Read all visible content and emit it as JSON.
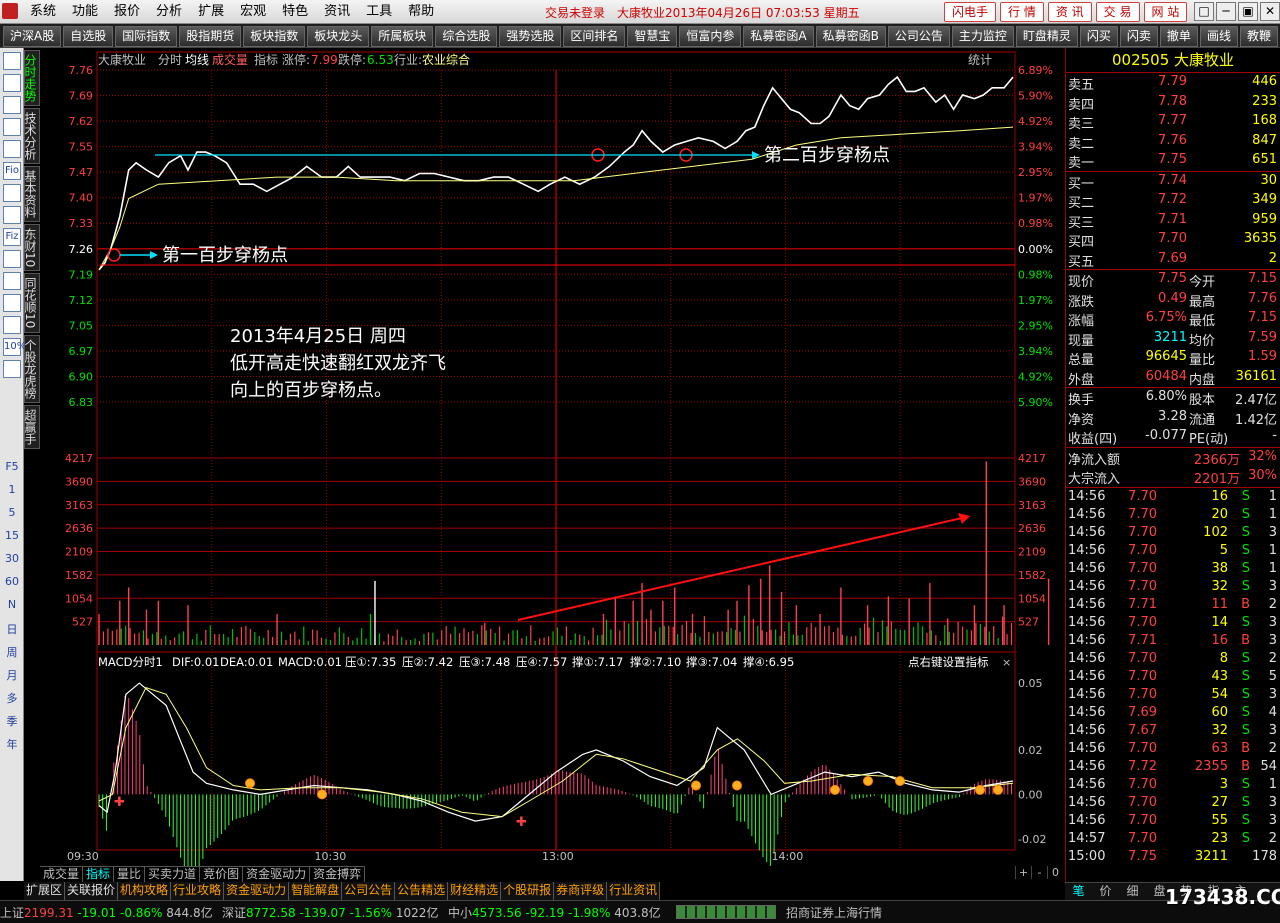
{
  "menubar": {
    "items": [
      "系统",
      "功能",
      "报价",
      "分析",
      "扩展",
      "宏观",
      "特色",
      "资讯",
      "工具",
      "帮助"
    ],
    "title": "交易未登录　大康牧业2013年04月26日 07:03:53 星期五",
    "links": [
      "闪电手",
      "行 情",
      "资 讯",
      "交 易",
      "网 站"
    ],
    "window_controls": [
      "□",
      "─",
      "▣",
      "✕"
    ]
  },
  "toolbar": {
    "buttons": [
      "沪深A股",
      "自选股",
      "国际指数",
      "股指期货",
      "板块指数",
      "板块龙头",
      "所属板块",
      "综合选股",
      "强势选股",
      "区间排名",
      "智慧宝",
      "恒富内参",
      "私募密函A",
      "私募密函B",
      "公司公告",
      "主力监控",
      "盯盘精灵",
      "闪买",
      "闪卖",
      "撤单",
      "画线",
      "教鞭"
    ]
  },
  "left_icons": [
    "page-icon",
    "table-icon",
    "line-chart-icon",
    "kline-icon",
    "report-icon",
    "fio-icon",
    "f10-icon",
    "star-icon",
    "fiz-icon",
    "news-icon",
    "search-icon",
    "wave-icon",
    "bars-icon",
    "percent-icon",
    "pen-icon"
  ],
  "left_icon_texts": [
    "",
    "",
    "",
    "",
    "",
    "Fio",
    "",
    "",
    "Fiz",
    "",
    "",
    "",
    "",
    "10%",
    ""
  ],
  "left_periods": [
    "F5",
    "1",
    "5",
    "15",
    "30",
    "60",
    "N",
    "日",
    "周",
    "月",
    "多",
    "季",
    "年"
  ],
  "vertical_tabs": [
    "分时走势",
    "技术分析",
    "基本资料",
    "东财10",
    "同花顺10",
    "个股龙虎榜",
    "超赢手"
  ],
  "chart": {
    "header": {
      "name": "大康牧业",
      "mode": "分时",
      "avg_label": "均线",
      "vol_label": "成交量",
      "indicator": "指标",
      "limit_up_label": "涨停:",
      "limit_up": "7.99",
      "limit_down_label": "跌停:",
      "limit_down": "6.53",
      "industry_label": "行业:",
      "industry": "农业综合",
      "stats": "统计"
    },
    "price_labels": [
      "7.76",
      "7.69",
      "7.62",
      "7.55",
      "7.47",
      "7.40",
      "7.33",
      "7.26",
      "7.19",
      "7.12",
      "7.05",
      "6.97",
      "6.90",
      "6.83"
    ],
    "pct_labels": [
      "6.89%",
      "5.90%",
      "4.92%",
      "3.94%",
      "2.95%",
      "1.97%",
      "0.98%",
      "0.00%",
      "0.98%",
      "1.97%",
      "2.95%",
      "3.94%",
      "4.92%",
      "5.90%"
    ],
    "vol_labels": [
      "4217",
      "3690",
      "3163",
      "2636",
      "2109",
      "1582",
      "1054",
      "527"
    ],
    "macd_header": [
      "MACD分时1",
      "DIF:0.01",
      "DEA:0.01",
      "MACD:0.01",
      "压①:7.35",
      "压②:7.42",
      "压③:7.48",
      "压④:7.57",
      "撑①:7.17",
      "撑②:7.10",
      "撑③:7.04",
      "撑④:6.95"
    ],
    "macd_hint": "点右键设置指标",
    "macd_labels": [
      "0.05",
      "0.02",
      "0.00",
      "-0.02"
    ],
    "time_labels": [
      "09:30",
      "10:30",
      "13:00",
      "14:00"
    ],
    "annotation1": "第一百步穿杨点",
    "annotation2": "第二百步穿杨点",
    "note_lines": [
      "2013年4月25日 周四",
      "低开高走快速翻红双龙齐飞",
      "向上的百步穿杨点。"
    ],
    "colors": {
      "up": "#ff4040",
      "down": "#00e000",
      "price": "#ffffff",
      "avg": "#ffff80",
      "grid": "#a00000",
      "axis": "#ff4040"
    }
  },
  "chart_data": {
    "type": "line",
    "title": "大康牧业 分时",
    "ylim": [
      6.83,
      7.76
    ],
    "time_range": [
      "09:30",
      "15:00"
    ],
    "series": [
      {
        "name": "价格",
        "points": [
          [
            0,
            7.2
          ],
          [
            4,
            7.22
          ],
          [
            8,
            7.26
          ],
          [
            14,
            7.35
          ],
          [
            20,
            7.48
          ],
          [
            25,
            7.5
          ],
          [
            32,
            7.48
          ],
          [
            40,
            7.46
          ],
          [
            47,
            7.5
          ],
          [
            55,
            7.52
          ],
          [
            60,
            7.48
          ],
          [
            66,
            7.53
          ],
          [
            72,
            7.53
          ],
          [
            78,
            7.52
          ],
          [
            86,
            7.5
          ],
          [
            95,
            7.44
          ],
          [
            104,
            7.44
          ],
          [
            113,
            7.42
          ],
          [
            122,
            7.44
          ],
          [
            131,
            7.46
          ],
          [
            140,
            7.49
          ],
          [
            150,
            7.46
          ],
          [
            160,
            7.46
          ],
          [
            168,
            7.49
          ],
          [
            176,
            7.46
          ],
          [
            186,
            7.46
          ],
          [
            196,
            7.46
          ],
          [
            206,
            7.45
          ],
          [
            216,
            7.47
          ],
          [
            226,
            7.47
          ],
          [
            236,
            7.46
          ],
          [
            246,
            7.45
          ],
          [
            256,
            7.45
          ],
          [
            266,
            7.46
          ],
          [
            276,
            7.46
          ],
          [
            286,
            7.44
          ],
          [
            296,
            7.42
          ],
          [
            304,
            7.44
          ],
          [
            314,
            7.46
          ],
          [
            324,
            7.44
          ],
          [
            334,
            7.46
          ],
          [
            344,
            7.49
          ],
          [
            354,
            7.53
          ],
          [
            360,
            7.55
          ],
          [
            366,
            7.59
          ],
          [
            372,
            7.56
          ],
          [
            380,
            7.53
          ],
          [
            388,
            7.55
          ],
          [
            396,
            7.56
          ],
          [
            404,
            7.57
          ],
          [
            414,
            7.56
          ],
          [
            422,
            7.54
          ],
          [
            430,
            7.56
          ],
          [
            436,
            7.59
          ],
          [
            442,
            7.6
          ],
          [
            448,
            7.66
          ],
          [
            454,
            7.71
          ],
          [
            460,
            7.68
          ],
          [
            466,
            7.65
          ],
          [
            472,
            7.64
          ],
          [
            480,
            7.61
          ],
          [
            486,
            7.61
          ],
          [
            492,
            7.63
          ],
          [
            500,
            7.69
          ],
          [
            506,
            7.66
          ],
          [
            512,
            7.65
          ],
          [
            518,
            7.68
          ],
          [
            526,
            7.69
          ],
          [
            532,
            7.72
          ],
          [
            538,
            7.74
          ],
          [
            544,
            7.7
          ],
          [
            550,
            7.7
          ],
          [
            556,
            7.71
          ],
          [
            564,
            7.67
          ],
          [
            570,
            7.69
          ],
          [
            576,
            7.65
          ],
          [
            582,
            7.69
          ],
          [
            590,
            7.68
          ],
          [
            596,
            7.69
          ],
          [
            602,
            7.71
          ],
          [
            610,
            7.71
          ],
          [
            616,
            7.74
          ]
        ]
      },
      {
        "name": "均价",
        "points": [
          [
            0,
            7.2
          ],
          [
            8,
            7.26
          ],
          [
            14,
            7.32
          ],
          [
            20,
            7.4
          ],
          [
            40,
            7.44
          ],
          [
            80,
            7.45
          ],
          [
            120,
            7.46
          ],
          [
            160,
            7.46
          ],
          [
            200,
            7.45
          ],
          [
            240,
            7.45
          ],
          [
            280,
            7.45
          ],
          [
            320,
            7.45
          ],
          [
            340,
            7.46
          ],
          [
            360,
            7.47
          ],
          [
            400,
            7.49
          ],
          [
            440,
            7.51
          ],
          [
            470,
            7.55
          ],
          [
            500,
            7.57
          ],
          [
            540,
            7.58
          ],
          [
            580,
            7.59
          ],
          [
            616,
            7.6
          ]
        ]
      }
    ],
    "volume_spikes": [
      [
        0,
        700
      ],
      [
        14,
        1000
      ],
      [
        20,
        1300
      ],
      [
        32,
        800
      ],
      [
        40,
        1000
      ],
      [
        60,
        900
      ],
      [
        120,
        700
      ],
      [
        183,
        700
      ],
      [
        186,
        1450
      ],
      [
        260,
        500
      ],
      [
        340,
        700
      ],
      [
        348,
        1100
      ],
      [
        360,
        1000
      ],
      [
        366,
        1400
      ],
      [
        372,
        800
      ],
      [
        380,
        1000
      ],
      [
        388,
        1300
      ],
      [
        400,
        700
      ],
      [
        424,
        800
      ],
      [
        430,
        1000
      ],
      [
        438,
        1350
      ],
      [
        446,
        1500
      ],
      [
        452,
        1800
      ],
      [
        460,
        1200
      ],
      [
        470,
        900
      ],
      [
        486,
        700
      ],
      [
        500,
        1300
      ],
      [
        518,
        900
      ],
      [
        532,
        1100
      ],
      [
        546,
        1050
      ],
      [
        560,
        1400
      ],
      [
        572,
        600
      ],
      [
        590,
        900
      ],
      [
        598,
        4150
      ],
      [
        610,
        900
      ],
      [
        640,
        1500
      ],
      [
        660,
        700
      ],
      [
        680,
        1000
      ],
      [
        698,
        2450
      ],
      [
        708,
        2000
      ],
      [
        716,
        800
      ],
      [
        728,
        2700
      ]
    ],
    "macd_range": [
      -0.025,
      0.055
    ],
    "macd_dif": [
      [
        0,
        -0.005
      ],
      [
        6,
        -0.008
      ],
      [
        12,
        0.01
      ],
      [
        20,
        0.045
      ],
      [
        30,
        0.05
      ],
      [
        40,
        0.045
      ],
      [
        50,
        0.04
      ],
      [
        60,
        0.025
      ],
      [
        70,
        0.01
      ],
      [
        80,
        0.005
      ],
      [
        100,
        0.002
      ],
      [
        120,
        0
      ],
      [
        140,
        0.002
      ],
      [
        160,
        0.004
      ],
      [
        180,
        0.003
      ],
      [
        200,
        0.002
      ],
      [
        220,
        0
      ],
      [
        240,
        -0.003
      ],
      [
        260,
        -0.008
      ],
      [
        280,
        -0.012
      ],
      [
        300,
        -0.01
      ],
      [
        320,
        0
      ],
      [
        340,
        0.01
      ],
      [
        360,
        0.018
      ],
      [
        370,
        0.02
      ],
      [
        390,
        0.015
      ],
      [
        410,
        0.008
      ],
      [
        430,
        0.004
      ],
      [
        450,
        0.012
      ],
      [
        460,
        0.03
      ],
      [
        470,
        0.025
      ],
      [
        480,
        0.02
      ],
      [
        490,
        0.01
      ],
      [
        500,
        0
      ],
      [
        520,
        0.005
      ],
      [
        540,
        0.01
      ],
      [
        560,
        0.008
      ],
      [
        580,
        0.01
      ],
      [
        600,
        0.005
      ],
      [
        620,
        0.002
      ],
      [
        640,
        0.001
      ],
      [
        660,
        0.004
      ],
      [
        680,
        0.006
      ]
    ],
    "macd_dea": [
      [
        0,
        -0.003
      ],
      [
        10,
        0
      ],
      [
        20,
        0.03
      ],
      [
        35,
        0.048
      ],
      [
        50,
        0.045
      ],
      [
        65,
        0.03
      ],
      [
        80,
        0.012
      ],
      [
        100,
        0.004
      ],
      [
        120,
        0.002
      ],
      [
        150,
        0.003
      ],
      [
        180,
        0.003
      ],
      [
        210,
        0.001
      ],
      [
        240,
        -0.002
      ],
      [
        270,
        -0.008
      ],
      [
        300,
        -0.01
      ],
      [
        320,
        -0.003
      ],
      [
        345,
        0.006
      ],
      [
        370,
        0.018
      ],
      [
        390,
        0.016
      ],
      [
        420,
        0.01
      ],
      [
        440,
        0.006
      ],
      [
        460,
        0.02
      ],
      [
        475,
        0.025
      ],
      [
        495,
        0.015
      ],
      [
        510,
        0.005
      ],
      [
        530,
        0.006
      ],
      [
        560,
        0.009
      ],
      [
        590,
        0.008
      ],
      [
        620,
        0.003
      ],
      [
        650,
        0.003
      ],
      [
        680,
        0.005
      ]
    ]
  },
  "chart_tabs": [
    "成交量",
    "指标",
    "量比",
    "买卖力道",
    "竞价图",
    "资金驱动力",
    "资金搏弈"
  ],
  "chart_tabs_active": 1,
  "nav_controls": [
    "+",
    "-",
    "0"
  ],
  "bottom_tabs": [
    "扩展区",
    "关联报价",
    "机构攻略",
    "行业攻略",
    "资金驱动力",
    "智能解盘",
    "公司公告",
    "公告精选",
    "财经精选",
    "个股研报",
    "券商评级",
    "行业资讯"
  ],
  "statusbar": {
    "sh_label": "上证",
    "sh": "2199.31",
    "sh_chg": "-19.01",
    "sh_pct": "-0.86%",
    "sh_amt": "844.8亿",
    "sz_label": "深证",
    "sz": "8772.58",
    "sz_chg": "-139.07",
    "sz_pct": "-1.56%",
    "sz_amt": "1022亿",
    "sm_label": "中小",
    "sm": "4573.56",
    "sm_chg": "-92.19",
    "sm_pct": "-1.98%",
    "sm_amt": "403.8亿",
    "broker": "招商证券上海行情"
  },
  "quote": {
    "title": "002505 大康牧业",
    "asks": [
      [
        "卖五",
        "7.79",
        "446"
      ],
      [
        "卖四",
        "7.78",
        "233"
      ],
      [
        "卖三",
        "7.77",
        "168"
      ],
      [
        "卖二",
        "7.76",
        "847"
      ],
      [
        "卖一",
        "7.75",
        "651"
      ]
    ],
    "bids": [
      [
        "买一",
        "7.74",
        "30"
      ],
      [
        "买二",
        "7.72",
        "349"
      ],
      [
        "买三",
        "7.71",
        "959"
      ],
      [
        "买四",
        "7.70",
        "3635"
      ],
      [
        "买五",
        "7.69",
        "2"
      ]
    ],
    "stats": [
      [
        "现价",
        "7.75",
        "今开",
        "7.15"
      ],
      [
        "涨跌",
        "0.49",
        "最高",
        "7.76"
      ],
      [
        "涨幅",
        "6.75%",
        "最低",
        "7.15"
      ],
      [
        "现量",
        "3211",
        "均价",
        "7.59"
      ],
      [
        "总量",
        "96645",
        "量比",
        "1.59"
      ],
      [
        "外盘",
        "60484",
        "内盘",
        "36161"
      ]
    ],
    "funds": [
      [
        "换手",
        "6.80%",
        "股本",
        "2.47亿"
      ],
      [
        "净资",
        "3.28",
        "流通",
        "1.42亿"
      ],
      [
        "收益(四)",
        "-0.077",
        "PE(动)",
        "-"
      ]
    ],
    "flows": [
      [
        "净流入额",
        "2366万",
        "32%"
      ],
      [
        "大宗流入",
        "2201万",
        "30%"
      ]
    ],
    "ticks": [
      [
        "14:56",
        "7.70",
        "16",
        "S",
        "1"
      ],
      [
        "14:56",
        "7.70",
        "20",
        "S",
        "1"
      ],
      [
        "14:56",
        "7.70",
        "102",
        "S",
        "3"
      ],
      [
        "14:56",
        "7.70",
        "5",
        "S",
        "1"
      ],
      [
        "14:56",
        "7.70",
        "38",
        "S",
        "1"
      ],
      [
        "14:56",
        "7.70",
        "32",
        "S",
        "3"
      ],
      [
        "14:56",
        "7.71",
        "11",
        "B",
        "2"
      ],
      [
        "14:56",
        "7.70",
        "14",
        "S",
        "3"
      ],
      [
        "14:56",
        "7.71",
        "16",
        "B",
        "3"
      ],
      [
        "14:56",
        "7.70",
        "8",
        "S",
        "2"
      ],
      [
        "14:56",
        "7.70",
        "43",
        "S",
        "5"
      ],
      [
        "14:56",
        "7.70",
        "54",
        "S",
        "3"
      ],
      [
        "14:56",
        "7.69",
        "60",
        "S",
        "4"
      ],
      [
        "14:56",
        "7.67",
        "32",
        "S",
        "3"
      ],
      [
        "14:56",
        "7.70",
        "63",
        "B",
        "2"
      ],
      [
        "14:56",
        "7.72",
        "2355",
        "B",
        "54"
      ],
      [
        "14:56",
        "7.70",
        "3",
        "S",
        "1"
      ],
      [
        "14:56",
        "7.70",
        "27",
        "S",
        "3"
      ],
      [
        "14:56",
        "7.70",
        "55",
        "S",
        "3"
      ],
      [
        "14:57",
        "7.70",
        "23",
        "S",
        "2"
      ],
      [
        "15:00",
        "7.75",
        "3211",
        "",
        "178"
      ]
    ]
  },
  "rp_tabs": [
    "笔",
    "价",
    "细",
    "盘",
    "势",
    "指",
    "主"
  ],
  "rp_tabs_active": 0,
  "watermark": "173438.COM"
}
